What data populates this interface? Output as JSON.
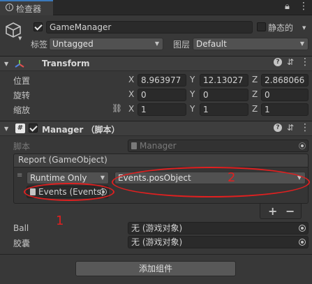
{
  "tab": {
    "title": "检查器"
  },
  "header": {
    "name": "GameManager",
    "static_label": "静态的",
    "tag_label": "标签",
    "tag_value": "Untagged",
    "layer_label": "图层",
    "layer_value": "Default"
  },
  "transform": {
    "title": "Transform",
    "rows": [
      {
        "label": "位置",
        "x": "8.963977",
        "y": "12.13027",
        "z": "2.868066"
      },
      {
        "label": "旋转",
        "x": "0",
        "y": "0",
        "z": "0"
      },
      {
        "label": "缩放",
        "x": "1",
        "y": "1",
        "z": "1"
      }
    ],
    "axis": {
      "x": "X",
      "y": "Y",
      "z": "Z"
    }
  },
  "manager": {
    "title": "Manager （脚本）",
    "script_label": "脚本",
    "script_value": "Manager",
    "event_title": "Report (GameObject)",
    "runtime": "Runtime Only",
    "function": "Events.posObject",
    "object": "Events (Events)",
    "plus": "+",
    "minus": "−",
    "ball_label": "Ball",
    "ball_value": "无 (游戏对象)",
    "capsule_label": "胶囊",
    "capsule_value": "无 (游戏对象)"
  },
  "annotations": {
    "one": "1",
    "two": "2"
  },
  "add_component": "添加组件",
  "colors": {
    "panel": "#383838",
    "field": "#2a2a2a",
    "header": "#3e3e3e",
    "annotation": "#e02020"
  }
}
